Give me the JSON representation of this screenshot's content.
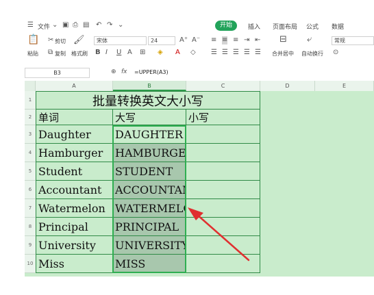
{
  "menubar": {
    "file_label": "文件",
    "tabs": [
      "开始",
      "插入",
      "页面布局",
      "公式",
      "数据"
    ],
    "active_tab": "开始"
  },
  "ribbon": {
    "paste": "粘贴",
    "cut": "剪切",
    "copy": "复制",
    "format_painter": "格式刷",
    "font_name": "宋体",
    "font_size": "24",
    "merge_center": "合并居中",
    "auto_wrap": "自动换行",
    "number_format": "常规"
  },
  "formula_bar": {
    "name_box": "B3",
    "fx_label": "fx",
    "formula": "=UPPER(A3)"
  },
  "grid": {
    "columns": [
      "A",
      "B",
      "C",
      "D",
      "E"
    ],
    "rows": [
      "1",
      "2",
      "3",
      "4",
      "5",
      "6",
      "7",
      "8",
      "9",
      "10"
    ],
    "title": "批量转换英文大小写",
    "headers": [
      "单词",
      "大写",
      "小写"
    ],
    "words": [
      "Daughter",
      "Hamburger",
      "Student",
      "Accountant",
      "Watermelon",
      "Principal",
      "University",
      "Miss"
    ],
    "upper": [
      "DAUGHTER",
      "HAMBURGER",
      "STUDENT",
      "ACCOUNTANT",
      "WATERMELON",
      "PRINCIPAL",
      "UNIVERSITY",
      "MISS"
    ]
  },
  "colors": {
    "accent": "#22a35a",
    "grid_bg": "#c9eccc",
    "cell_border": "#2f8a46",
    "selection": "#2fae51",
    "arrow": "#e03030"
  }
}
